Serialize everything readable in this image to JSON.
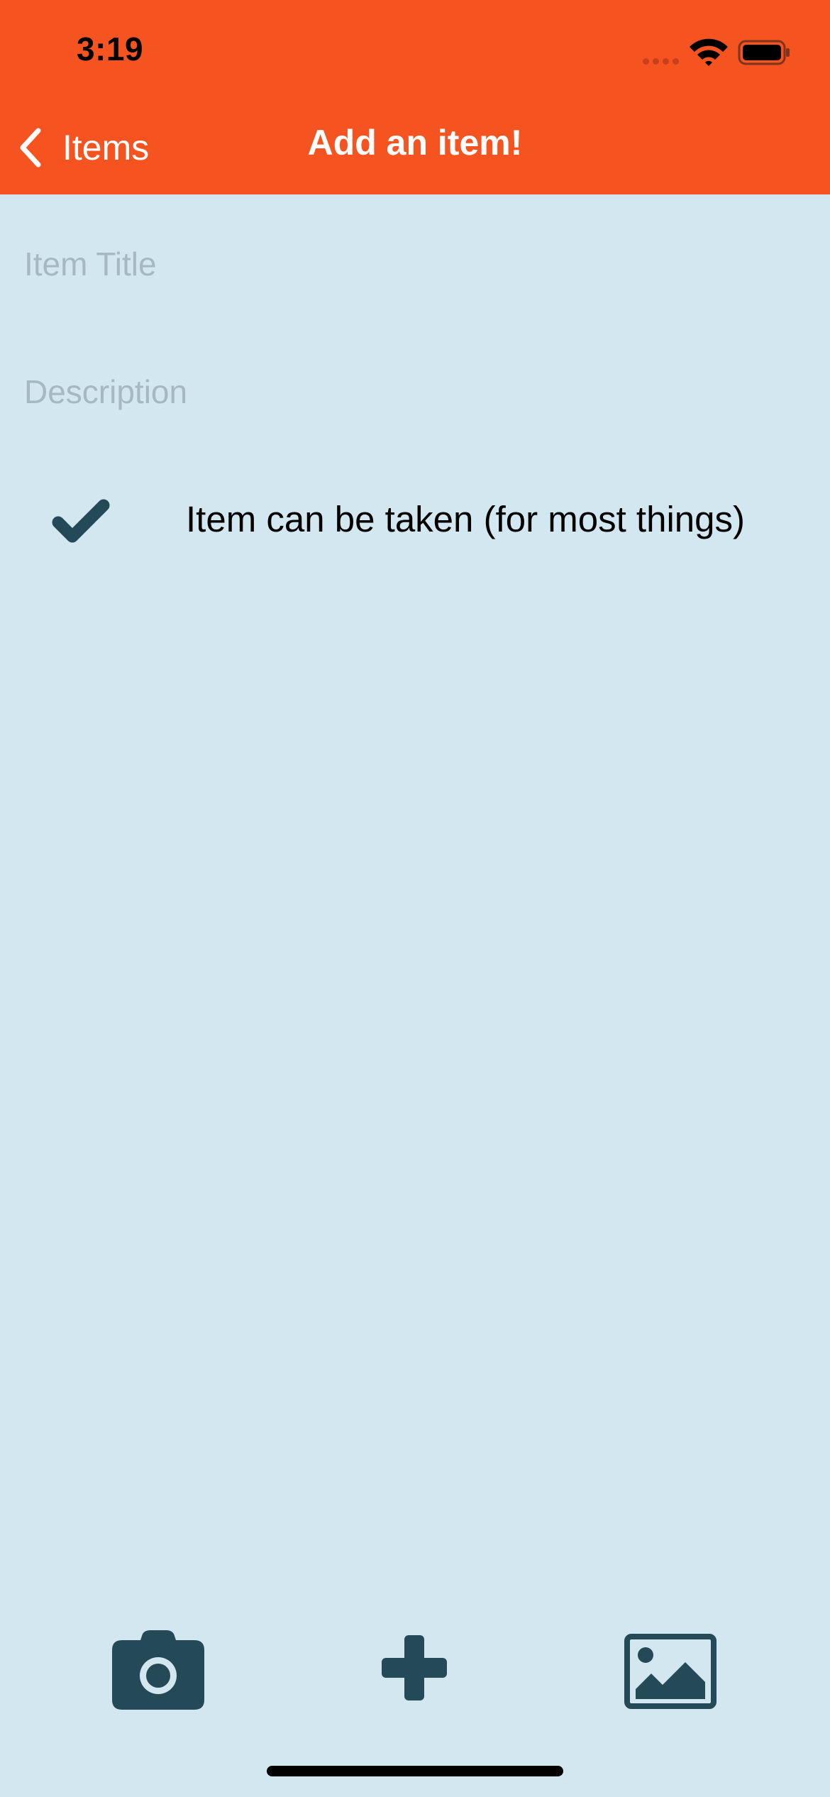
{
  "status_bar": {
    "time": "3:19"
  },
  "nav": {
    "back_label": "Items",
    "title": "Add an item!"
  },
  "form": {
    "title_field": {
      "value": "",
      "placeholder": "Item Title"
    },
    "description_field": {
      "value": "",
      "placeholder": "Description"
    },
    "can_be_taken": {
      "checked": true,
      "label": "Item can be taken (for most things)"
    }
  },
  "toolbar": {
    "items": [
      {
        "icon": "camera-icon"
      },
      {
        "icon": "plus-icon"
      },
      {
        "icon": "image-icon"
      }
    ]
  },
  "colors": {
    "header_bg": "#f55420",
    "page_bg": "#d3e7f0",
    "icon_color": "#234a56",
    "placeholder": "#a6b9c3"
  }
}
